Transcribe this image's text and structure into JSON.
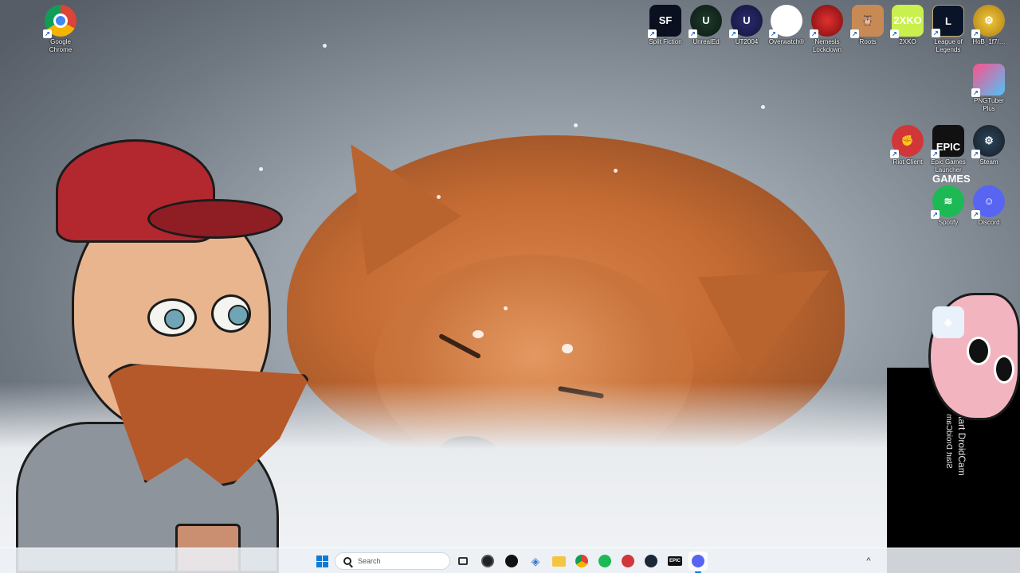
{
  "desktop": {
    "left_icons": [
      {
        "name": "google-chrome",
        "label": "Google Chrome"
      }
    ],
    "top_icons": [
      {
        "name": "split-fiction",
        "label": "Split Fiction",
        "glyph": "SF"
      },
      {
        "name": "unrealed",
        "label": "UnrealEd",
        "glyph": "U"
      },
      {
        "name": "ut2004",
        "label": "UT2004",
        "glyph": "U"
      },
      {
        "name": "overwatch",
        "label": "Overwatch®",
        "glyph": "◎"
      },
      {
        "name": "nemesis-lockdown",
        "label": "Nemesis Lockdown",
        "glyph": ""
      },
      {
        "name": "roots",
        "label": "Roots",
        "glyph": "🦉"
      },
      {
        "name": "2xko",
        "label": "2XKO",
        "glyph": "2XKO"
      },
      {
        "name": "league-of-legends",
        "label": "League of Legends",
        "glyph": "L"
      },
      {
        "name": "hob",
        "label": "HoB_1f7/…",
        "glyph": "⚙"
      }
    ],
    "right_icons": [
      {
        "name": "pngtuber-plus",
        "label": "PNGTuber Plus",
        "glyph": ""
      },
      {
        "name": "riot-client",
        "label": "Riot Client",
        "glyph": "✊"
      },
      {
        "name": "epic-games-launcher",
        "label": "Epic Games Launcher",
        "glyph": "EPIC GAMES"
      },
      {
        "name": "steam",
        "label": "Steam",
        "glyph": "⚙"
      },
      {
        "name": "spotify",
        "label": "Spotify",
        "glyph": "≋"
      },
      {
        "name": "discord",
        "label": "Discord",
        "glyph": "☺"
      }
    ],
    "droidcam_glyph": "◈"
  },
  "overlay": {
    "droidcam_text": "Start DroidCam",
    "droidcam_mirror_text": "Start DroidCam"
  },
  "taskbar": {
    "search_placeholder": "Search",
    "apps": [
      "task-view",
      "obs",
      "app-dark",
      "droidcam",
      "file-explorer",
      "chrome",
      "spotify",
      "riot-client",
      "steam",
      "epic-games",
      "discord"
    ],
    "epic_label": "EPIC",
    "chevron": "^"
  },
  "colors": {
    "accent": "#0a7cd8",
    "taskbar_bg": "#ecf0f5"
  }
}
